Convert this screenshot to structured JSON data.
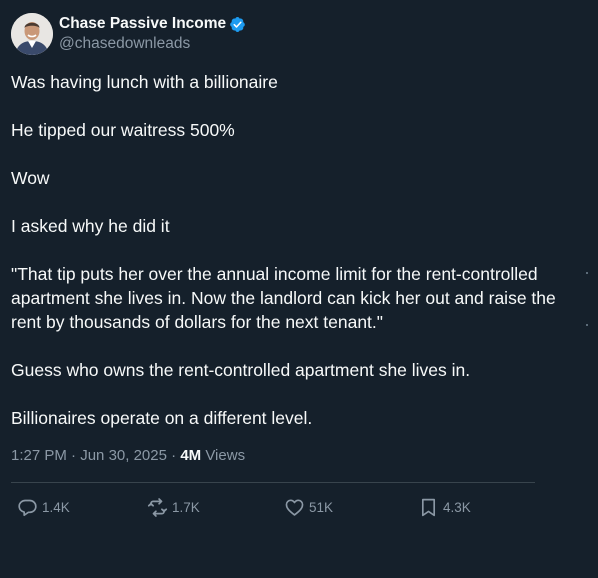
{
  "colors": {
    "background": "#15202b",
    "text_primary": "#f7f9f9",
    "text_secondary": "#8b98a5",
    "verified_badge": "#1d9bf0",
    "divider": "#38444d"
  },
  "author": {
    "display_name": "Chase Passive Income",
    "handle": "@chasedownleads",
    "verified_icon": "verified-badge-icon"
  },
  "tweet": {
    "paragraphs": [
      "Was having lunch with a billionaire",
      "He tipped our waitress 500%",
      "Wow",
      "I asked why he did it",
      "\"That tip puts her over the annual income limit for the rent-controlled apartment she lives in. Now the landlord can kick her out and raise the rent by thousands of dollars for the next tenant.\"",
      "Guess who owns the rent-controlled apartment she lives in.",
      "Billionaires operate on a different level."
    ],
    "time": "1:27 PM",
    "separator": "·",
    "date": "Jun 30, 2025",
    "views_count": "4M",
    "views_label": "Views"
  },
  "actions": {
    "reply": {
      "icon": "reply-icon",
      "count": "1.4K"
    },
    "repost": {
      "icon": "repost-icon",
      "count": "1.7K"
    },
    "like": {
      "icon": "heart-icon",
      "count": "51K"
    },
    "bookmark": {
      "icon": "bookmark-icon",
      "count": "4.3K"
    }
  }
}
